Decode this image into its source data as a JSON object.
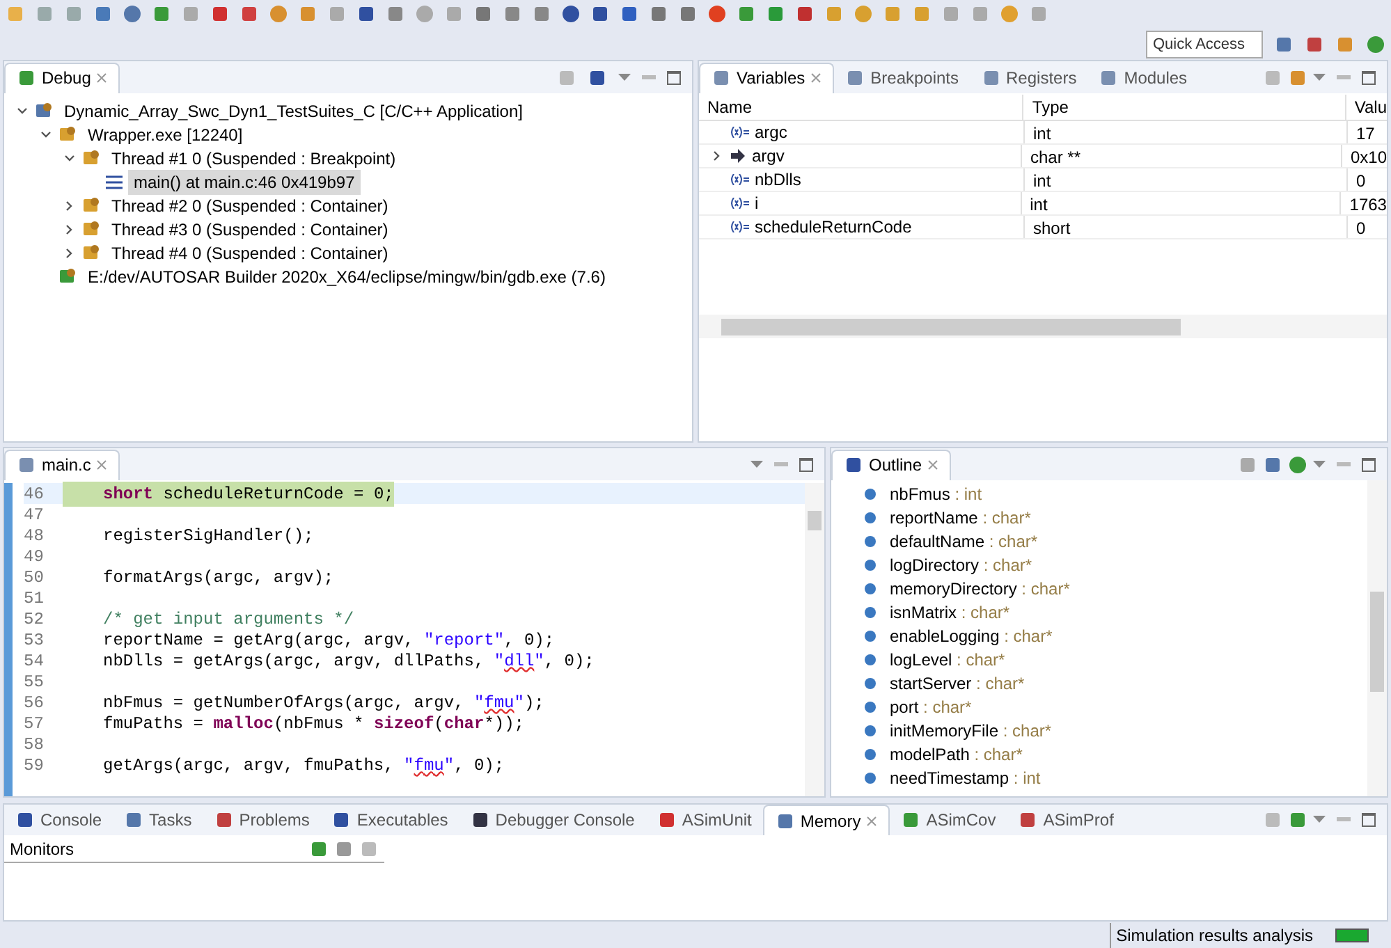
{
  "toolbar": {
    "quick_access": {
      "placeholder": "Quick Access"
    }
  },
  "debug_view": {
    "tab": {
      "label": "Debug",
      "selected": true
    },
    "tree": [
      {
        "label": "Dynamic_Array_Swc_Dyn1_TestSuites_C [C/C++ Application]",
        "kind": "launch",
        "expanded": true,
        "selected": false,
        "children": [
          {
            "label": "Wrapper.exe [12240]",
            "kind": "process",
            "expanded": true,
            "selected": false,
            "children": [
              {
                "label": "Thread #1 0 (Suspended : Breakpoint)",
                "kind": "thread",
                "expanded": true,
                "selected": false,
                "children": [
                  {
                    "label": "main() at main.c:46 0x419b97",
                    "kind": "frame",
                    "selected": true
                  }
                ]
              },
              {
                "label": "Thread #2 0 (Suspended : Container)",
                "kind": "thread",
                "expanded": false,
                "selected": false
              },
              {
                "label": "Thread #3 0 (Suspended : Container)",
                "kind": "thread",
                "expanded": false,
                "selected": false
              },
              {
                "label": "Thread #4 0 (Suspended : Container)",
                "kind": "thread",
                "expanded": false,
                "selected": false
              }
            ]
          },
          {
            "label": "E:/dev/AUTOSAR Builder 2020x_X64/eclipse/mingw/bin/gdb.exe (7.6)",
            "kind": "debugger",
            "selected": false
          }
        ]
      }
    ]
  },
  "variables_view": {
    "tabs": [
      {
        "label": "Variables",
        "selected": true
      },
      {
        "label": "Breakpoints",
        "selected": false
      },
      {
        "label": "Registers",
        "selected": false
      },
      {
        "label": "Modules",
        "selected": false
      }
    ],
    "columns": [
      "Name",
      "Type",
      "Valu"
    ],
    "rows": [
      {
        "name": "argc",
        "type": "int",
        "value": "17",
        "kind": "variable"
      },
      {
        "name": "argv",
        "type": "char **",
        "value": "0x10",
        "kind": "pointer"
      },
      {
        "name": "nbDlls",
        "type": "int",
        "value": "0",
        "kind": "variable"
      },
      {
        "name": "i",
        "type": "int",
        "value": "1763",
        "kind": "variable"
      },
      {
        "name": "scheduleReturnCode",
        "type": "short",
        "value": "0",
        "kind": "variable"
      }
    ]
  },
  "editor": {
    "tab": {
      "label": "main.c",
      "selected": true
    },
    "lines": [
      {
        "number": "46",
        "current": true,
        "tokens": [
          {
            "text": "short",
            "kind": "keyword"
          },
          {
            "text": " scheduleReturnCode = 0;",
            "kind": "plain"
          }
        ]
      },
      {
        "number": "47",
        "current": false
      },
      {
        "number": "48",
        "current": false,
        "tokens": [
          {
            "text": "registerSigHandler();",
            "kind": "plain"
          }
        ]
      },
      {
        "number": "49",
        "current": false
      },
      {
        "number": "50",
        "current": false,
        "tokens": [
          {
            "text": "formatArgs(argc, argv);",
            "kind": "plain"
          }
        ]
      },
      {
        "number": "51",
        "current": false
      },
      {
        "number": "52",
        "current": false,
        "tokens": [
          {
            "text": "/* get input arguments */",
            "kind": "comment"
          }
        ]
      },
      {
        "number": "53",
        "current": false,
        "tokens": [
          {
            "text": "reportName = getArg(argc, argv, ",
            "kind": "plain"
          },
          {
            "text": "\"report\"",
            "kind": "string"
          },
          {
            "text": ", 0);",
            "kind": "plain"
          }
        ]
      },
      {
        "number": "54",
        "current": false,
        "tokens": [
          {
            "text": "nbDlls = getArgs(argc, argv, dllPaths, ",
            "kind": "plain"
          },
          {
            "text": "\"",
            "kind": "string"
          },
          {
            "text": "dll",
            "kind": "misspelled"
          },
          {
            "text": "\"",
            "kind": "string"
          },
          {
            "text": ", 0);",
            "kind": "plain"
          }
        ]
      },
      {
        "number": "55",
        "current": false
      },
      {
        "number": "56",
        "current": false,
        "tokens": [
          {
            "text": "nbFmus = getNumberOfArgs(argc, argv, ",
            "kind": "plain"
          },
          {
            "text": "\"",
            "kind": "string"
          },
          {
            "text": "fmu",
            "kind": "misspelled"
          },
          {
            "text": "\"",
            "kind": "string"
          },
          {
            "text": ");",
            "kind": "plain"
          }
        ]
      },
      {
        "number": "57",
        "current": false,
        "tokens": [
          {
            "text": "fmuPaths = ",
            "kind": "plain"
          },
          {
            "text": "malloc",
            "kind": "keyword"
          },
          {
            "text": "(nbFmus * ",
            "kind": "plain"
          },
          {
            "text": "sizeof",
            "kind": "keyword"
          },
          {
            "text": "(",
            "kind": "plain"
          },
          {
            "text": "char",
            "kind": "keyword"
          },
          {
            "text": "*));",
            "kind": "plain"
          }
        ]
      },
      {
        "number": "58",
        "current": false
      },
      {
        "number": "59",
        "current": false,
        "tokens": [
          {
            "text": "getArgs(argc, argv, fmuPaths, ",
            "kind": "plain"
          },
          {
            "text": "\"",
            "kind": "string"
          },
          {
            "text": "fmu",
            "kind": "misspelled"
          },
          {
            "text": "\"",
            "kind": "string"
          },
          {
            "text": ", 0);",
            "kind": "plain"
          }
        ]
      }
    ]
  },
  "outline_view": {
    "tab": {
      "label": "Outline",
      "selected": true
    },
    "items": [
      {
        "name": "nbFmus",
        "type": " : int"
      },
      {
        "name": "reportName",
        "type": " : char*"
      },
      {
        "name": "defaultName",
        "type": " : char*"
      },
      {
        "name": "logDirectory",
        "type": " : char*"
      },
      {
        "name": "memoryDirectory",
        "type": " : char*"
      },
      {
        "name": "isnMatrix",
        "type": " : char*"
      },
      {
        "name": "enableLogging",
        "type": " : char*"
      },
      {
        "name": "logLevel",
        "type": " : char*"
      },
      {
        "name": "startServer",
        "type": " : char*"
      },
      {
        "name": "port",
        "type": " : char*"
      },
      {
        "name": "initMemoryFile",
        "type": " : char*"
      },
      {
        "name": "modelPath",
        "type": " : char*"
      },
      {
        "name": "needTimestamp",
        "type": " : int"
      }
    ]
  },
  "bottom_panel": {
    "tabs": [
      {
        "label": "Console",
        "selected": false
      },
      {
        "label": "Tasks",
        "selected": false
      },
      {
        "label": "Problems",
        "selected": false
      },
      {
        "label": "Executables",
        "selected": false
      },
      {
        "label": "Debugger Console",
        "selected": false
      },
      {
        "label": "ASimUnit",
        "selected": false
      },
      {
        "label": "Memory",
        "selected": true
      },
      {
        "label": "ASimCov",
        "selected": false
      },
      {
        "label": "ASimProf",
        "selected": false
      }
    ],
    "monitors_label": "Monitors"
  },
  "status_bar": {
    "message": "Simulation results analysis"
  }
}
